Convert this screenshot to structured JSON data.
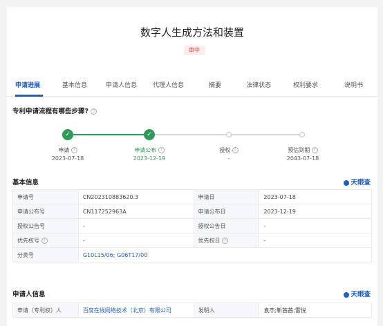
{
  "header": {
    "title": "数字人生成方法和装置",
    "status": "审中"
  },
  "tabs": [
    {
      "label": "申请进展",
      "active": true
    },
    {
      "label": "基本信息"
    },
    {
      "label": "申请人信息"
    },
    {
      "label": "代理人信息"
    },
    {
      "label": "摘要"
    },
    {
      "label": "法律状态"
    },
    {
      "label": "权利要求"
    },
    {
      "label": "说明书"
    }
  ],
  "process": {
    "question": "专利申请流程有哪些步骤?",
    "steps": [
      {
        "label": "申请",
        "date": "2023-07-18",
        "done": true
      },
      {
        "label": "申请公布",
        "date": "2023-12-19",
        "done": true
      },
      {
        "label": "授权",
        "date": "-",
        "done": false
      },
      {
        "label": "预估到期",
        "date": "2043-07-18",
        "done": false
      }
    ]
  },
  "basic_info": {
    "title": "基本信息",
    "brand": "天眼查",
    "rows": [
      {
        "k1": "申请号",
        "v1": "CN202310883620.3",
        "k2": "申请日",
        "v2": "2023-07-18"
      },
      {
        "k1": "申请公布号",
        "v1": "CN117252963A",
        "k2": "申请公布日",
        "v2": "2023-12-19"
      },
      {
        "k1": "授权公告号",
        "v1": "-",
        "k2": "授权公告日",
        "v2": "-"
      },
      {
        "k1": "优先权号",
        "v1": "-",
        "k2": "优先权日",
        "v2": "-"
      },
      {
        "k1": "分类号",
        "v1": "G10L15/06;   G06T17/00"
      }
    ]
  },
  "applicant_info": {
    "title": "申请人信息",
    "brand": "天眼查",
    "k1": "申请（专利权）人",
    "v1": "百度在线网络技术（北京）有限公司",
    "k2": "发明人",
    "v2": "袁杰;靳茜茜;雷悦"
  },
  "icons": {
    "help": "help-circle-icon",
    "check": "check-icon",
    "brand": "tianyancha-logo-icon"
  },
  "colors": {
    "accent": "#1c5fc9",
    "progress_done": "#2e9a57",
    "status": "#e3473c"
  }
}
